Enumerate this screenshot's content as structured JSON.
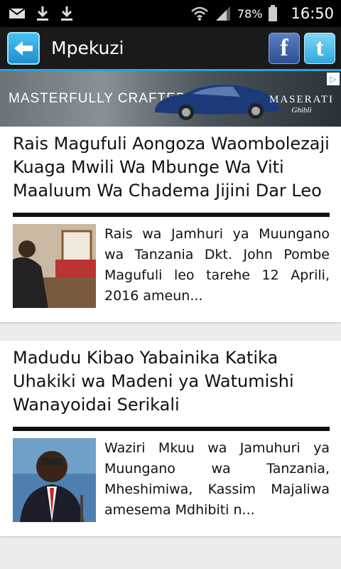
{
  "status": {
    "battery": "78%",
    "time": "16:50"
  },
  "app": {
    "title": "Mpekuzi",
    "facebook": "f",
    "twitter": "t"
  },
  "ad": {
    "tagline": "MASTERFULLY CRAFTED",
    "brand": "MASERATI",
    "model": "Ghibli"
  },
  "articles": [
    {
      "title": "Rais Magufuli Aongoza Waombolezaji Kuaga Mwili Wa Mbunge Wa Viti Maaluum Wa Chadema Jijini Dar Leo",
      "excerpt": "Rais wa Jamhuri ya Muungano wa Tanzania Dkt. John Pombe Magufuli leo tarehe 12 Aprili, 2016 ameun..."
    },
    {
      "title": "Madudu Kibao Yabainika Katika Uhakiki wa Madeni ya Watumishi Wanayoidai Serikali",
      "excerpt": "Waziri Mkuu wa Jamuhuri ya Muungano wa Tanzania, Mheshimiwa, Kassim Majaliwa amesema Mdhibiti n..."
    }
  ],
  "colors": {
    "accent": "#2aa3d6",
    "appbar": "#1a1a1a"
  }
}
